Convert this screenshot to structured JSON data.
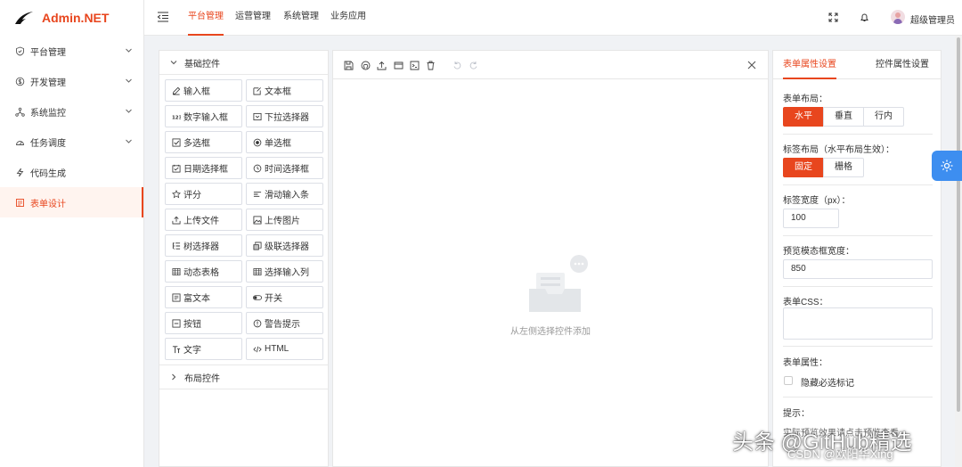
{
  "app": {
    "title": "Admin.NET"
  },
  "sidebar": {
    "items": [
      {
        "label": "平台管理",
        "icon": "shield-icon",
        "expandable": true
      },
      {
        "label": "开发管理",
        "icon": "circle-dollar-icon",
        "expandable": true
      },
      {
        "label": "系统监控",
        "icon": "network-icon",
        "expandable": true
      },
      {
        "label": "任务调度",
        "icon": "gauge-icon",
        "expandable": true
      },
      {
        "label": "代码生成",
        "icon": "lightning-icon",
        "expandable": false
      },
      {
        "label": "表单设计",
        "icon": "form-icon",
        "expandable": false,
        "active": true
      }
    ]
  },
  "topbar": {
    "tabs": [
      {
        "label": "平台管理",
        "active": true
      },
      {
        "label": "运营管理"
      },
      {
        "label": "系统管理"
      },
      {
        "label": "业务应用"
      }
    ],
    "fullscreen_icon": "fullscreen-icon",
    "bell_icon": "bell-icon",
    "username": "超级管理员"
  },
  "components": {
    "basic_group": "基础控件",
    "basic_items": [
      {
        "label": "输入框",
        "icon": "edit-icon"
      },
      {
        "label": "文本框",
        "icon": "text-box-icon"
      },
      {
        "label": "数字输入框",
        "icon": "number-icon"
      },
      {
        "label": "下拉选择器",
        "icon": "dropdown-icon"
      },
      {
        "label": "多选框",
        "icon": "checkbox-icon"
      },
      {
        "label": "单选框",
        "icon": "radio-icon"
      },
      {
        "label": "日期选择框",
        "icon": "calendar-icon"
      },
      {
        "label": "时间选择框",
        "icon": "clock-icon"
      },
      {
        "label": "评分",
        "icon": "star-icon"
      },
      {
        "label": "滑动输入条",
        "icon": "slider-icon"
      },
      {
        "label": "上传文件",
        "icon": "upload-icon"
      },
      {
        "label": "上传图片",
        "icon": "image-icon"
      },
      {
        "label": "树选择器",
        "icon": "tree-icon"
      },
      {
        "label": "级联选择器",
        "icon": "cascade-icon"
      },
      {
        "label": "动态表格",
        "icon": "table-icon"
      },
      {
        "label": "选择输入列",
        "icon": "table-icon"
      },
      {
        "label": "富文本",
        "icon": "richtext-icon"
      },
      {
        "label": "开关",
        "icon": "switch-icon"
      },
      {
        "label": "按钮",
        "icon": "button-icon"
      },
      {
        "label": "警告提示",
        "icon": "alert-icon"
      },
      {
        "label": "文字",
        "icon": "text-icon"
      },
      {
        "label": "HTML",
        "icon": "code-icon"
      }
    ],
    "layout_group": "布局控件"
  },
  "canvas": {
    "toolbar_icons": [
      "save-icon",
      "github-icon",
      "upload-icon",
      "preview-icon",
      "code-icon",
      "delete-icon",
      "undo-icon",
      "redo-icon"
    ],
    "empty_text": "从左侧选择控件添加"
  },
  "properties": {
    "tabs": [
      {
        "label": "表单属性设置",
        "active": true
      },
      {
        "label": "控件属性设置"
      }
    ],
    "layout": {
      "label": "表单布局：",
      "options": [
        "水平",
        "垂直",
        "行内"
      ],
      "selected": "水平"
    },
    "label_layout": {
      "label": "标签布局（水平布局生效）：",
      "options": [
        "固定",
        "栅格"
      ],
      "selected": "固定"
    },
    "label_width": {
      "label": "标签宽度（px）：",
      "value": "100"
    },
    "modal_width": {
      "label": "预览模态框宽度：",
      "value": "850"
    },
    "css": {
      "label": "表单CSS：",
      "value": ""
    },
    "attrs": {
      "label": "表单属性：",
      "hide_required": "隐藏必选标记",
      "hide_required_checked": false
    },
    "tip": {
      "label": "提示：",
      "text": "实际预览效果请点击预览查看"
    }
  },
  "watermark": {
    "line1": "头条 @GitHub精选",
    "line2": "CSDN @欧阳华Xing"
  }
}
